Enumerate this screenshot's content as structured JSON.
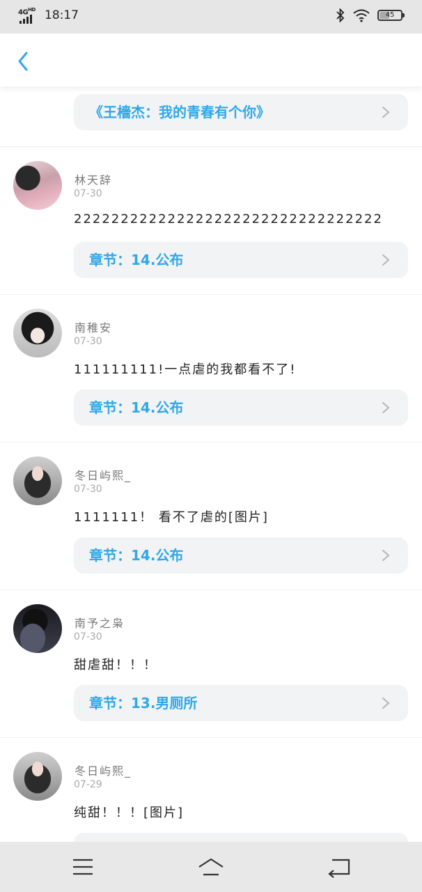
{
  "status_bar": {
    "network": "4G",
    "network_sub": "HD",
    "time": "18:17",
    "battery": "45"
  },
  "top_item": {
    "chapter_label": "《王檣杰：我的青春有个你》"
  },
  "comments": [
    {
      "name": "林天辞",
      "date": "07-30",
      "content": "222222222222222222222222222222222",
      "chapter": "章节：14.公布"
    },
    {
      "name": "南稚安",
      "date": "07-30",
      "content": "111111111!一点虐的我都看不了!",
      "chapter": "章节：14.公布"
    },
    {
      "name": "冬日屿熙_",
      "date": "07-30",
      "content": "1111111！ 看不了虐的[图片]",
      "chapter": "章节：14.公布"
    },
    {
      "name": "南予之枭",
      "date": "07-30",
      "content": "甜虐甜！！！",
      "chapter": "章节：13.男厕所"
    },
    {
      "name": "冬日屿熙_",
      "date": "07-29",
      "content": "纯甜！！！[图片]",
      "chapter": ""
    }
  ],
  "colors": {
    "accent": "#2fa8e8",
    "pill_bg": "#f2f3f5",
    "status_bg": "#e6e6e6",
    "nav_bg": "#e8e8e8"
  },
  "icons": {
    "back": "chevron-left-icon",
    "chevron": "chevron-right-icon",
    "menu": "menu-icon",
    "home": "home-icon",
    "return": "return-icon"
  }
}
